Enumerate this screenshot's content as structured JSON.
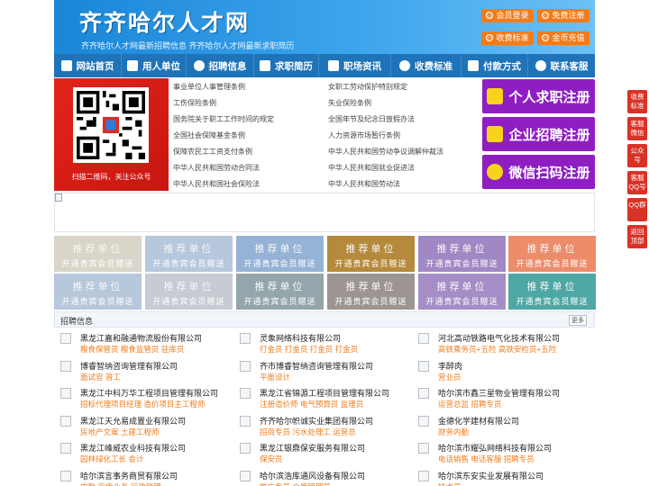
{
  "header": {
    "logo": "齐齐哈尔人才网",
    "slogan": "齐齐哈尔人才网最新招聘信息    齐齐哈尔人才网最新求职简历",
    "buttons": [
      {
        "label": "会员登录",
        "icon": "user-icon"
      },
      {
        "label": "免费注册",
        "icon": "user-plus-icon"
      },
      {
        "label": "收费标准",
        "icon": "yen-icon"
      },
      {
        "label": "金币充值",
        "icon": "coin-icon"
      }
    ]
  },
  "nav": [
    {
      "label": "网站首页",
      "icon": "home-icon"
    },
    {
      "label": "用人单位",
      "icon": "building-icon"
    },
    {
      "label": "招聘信息",
      "icon": "megaphone-icon"
    },
    {
      "label": "求职简历",
      "icon": "document-icon"
    },
    {
      "label": "职场资讯",
      "icon": "news-icon"
    },
    {
      "label": "收费标准",
      "icon": "yen-icon"
    },
    {
      "label": "付款方式",
      "icon": "card-icon"
    },
    {
      "label": "联系客服",
      "icon": "phone-icon"
    }
  ],
  "qr_caption": "扫描二维码，关注公众号",
  "regulations_left": [
    "事业单位人事管理条例",
    "工伤保险条例",
    "国务院关于职工工作时间的规定",
    "全国社会保障基金条例",
    "保障农民工工资支付条例",
    "中华人民共和国劳动合同法",
    "中华人民共和国社会保险法"
  ],
  "regulations_right": [
    "女职工劳动保护特别规定",
    "失业保险条例",
    "全国年节及纪念日放假办法",
    "人力资源市场暂行条例",
    "中华人民共和国劳动争议调解仲裁法",
    "中华人民共和国就业促进法",
    "中华人民共和国劳动法"
  ],
  "register_buttons": [
    {
      "label": "个人求职注册",
      "icon": "person-icon"
    },
    {
      "label": "企业招聘注册",
      "icon": "company-icon"
    },
    {
      "label": "微信扫码注册",
      "icon": "wechat-icon"
    }
  ],
  "tiles": {
    "title": "推荐单位",
    "subtitle": "开通贵宾会员赠送",
    "colors": [
      "#d9d5c9",
      "#b7c7dc",
      "#95b3d6",
      "#b58a3c",
      "#a088c4",
      "#ec8c6b",
      "#b7c7dc",
      "#c7cbd3",
      "#95a5ac",
      "#9c9592",
      "#a58ec7",
      "#4ea7a5"
    ]
  },
  "jobs": {
    "title": "招聘信息",
    "more": "更多",
    "items": [
      {
        "company": "黑龙江嘉和融通物流股份有限公司",
        "positions": "粮食保管员 粮食监管员 驻库员"
      },
      {
        "company": "灵象网络科技有限公司",
        "positions": "打金员 打金员 打金员 打金员"
      },
      {
        "company": "河北高动铁路电气化技术有限公司",
        "positions": "高铁乘务员+五险 高铁安检员+五险"
      },
      {
        "company": "博睿智纳咨询管理有限公司",
        "positions": "面试官 普工"
      },
      {
        "company": "齐市博睿智纳咨询管理有限公司",
        "positions": "平面设计"
      },
      {
        "company": "李醉肉",
        "positions": "营业员"
      },
      {
        "company": "黑龙江中科万华工程项目管理有限公司",
        "positions": "招标代理项目经理 造价项目主工程师"
      },
      {
        "company": "黑龙江省锦源工程项目管理有限公司",
        "positions": "注册造价师 电气预算员 监理员"
      },
      {
        "company": "哈尔滨市鑫三星物业管理有限公司",
        "positions": "运营总监 招聘专员"
      },
      {
        "company": "黑龙江天允易成置业有限公司",
        "positions": "房地产文案 土建工程师"
      },
      {
        "company": "齐齐哈尔帜诚实业集团有限公司",
        "positions": "招商专员 污水处理工 运营总"
      },
      {
        "company": "金德化学建材有限公司",
        "positions": "财务内勤"
      },
      {
        "company": "黑龙江峰威农业科技有限公司",
        "positions": "园林绿化工长 会计"
      },
      {
        "company": "黑龙江银鼎保安服务有限公司",
        "positions": "保安员"
      },
      {
        "company": "哈尔滨市耀弘网络科技有限公司",
        "positions": "电话销售 电话客服 招聘专员"
      },
      {
        "company": "哈尔滨言事务商贸有限公司",
        "positions": "内勤 宣传业务 行政助理"
      },
      {
        "company": "哈尔滨浩库通风设备有限公司",
        "positions": "推广专员 仓库管理员"
      },
      {
        "company": "哈尔滨东安实业发展有限公司",
        "positions": "技术员"
      }
    ]
  },
  "float_menu": [
    {
      "label": "收费标准"
    },
    {
      "label": "客服微信"
    },
    {
      "label": "公众号"
    },
    {
      "label": "客服QQ号"
    },
    {
      "label": "QQ群"
    },
    {
      "label": "返回顶部"
    }
  ]
}
